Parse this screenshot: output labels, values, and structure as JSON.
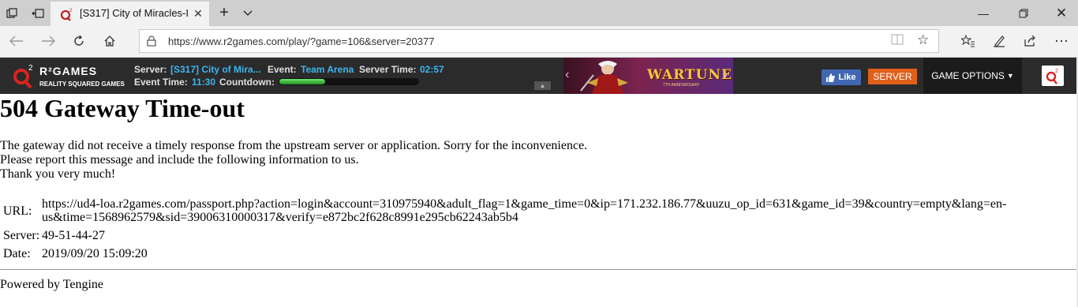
{
  "browser": {
    "tab_title": "[S317] City of Miracles-I",
    "url": "https://www.r2games.com/play/?game=106&server=20377"
  },
  "gamebar": {
    "logo_name": "R²GAMES",
    "logo_sub": "REALITY SQUARED GAMES",
    "server_label": "Server:",
    "server_value": "[S317] City of Mira...",
    "event_label": "Event:",
    "event_value": "Team Arena",
    "server_time_label": "Server Time:",
    "server_time_value": "02:57",
    "event_time_label": "Event Time:",
    "event_time_value": "11:30",
    "countdown_label": "Countdown:",
    "countdown_progress": 0.33,
    "banner_title": "WARTUNE",
    "banner_sub": "7TH ANNIVERSARY",
    "like_label": "Like",
    "server_button": "SERVER",
    "game_options": "GAME OPTIONS"
  },
  "page": {
    "title": "504 Gateway Time-out",
    "line1": "The gateway did not receive a timely response from the upstream server or application. Sorry for the inconvenience.",
    "line2": "Please report this message and include the following information to us.",
    "line3": "Thank you very much!",
    "url_label": "URL:",
    "url_value_1": "https://ud4-loa.r2games.com/passport.php?action=login&account=310975940&adult_flag=1&game_time=0&ip=171.232.186.77&uuzu_op_id=631&game_id=39&country=empty&lang=en-",
    "url_value_2": "us&time=1568962579&sid=39006310000317&verify=e872bc2f628c8991e295cb62243ab5b4",
    "server_label": "Server:",
    "server_value": "49-51-44-27",
    "date_label": "Date:",
    "date_value": "2019/09/20 15:09:20",
    "footer": "Powered by Tengine"
  },
  "colors": {
    "gamebar_bg": "#2b2b2b",
    "accent_blue": "#3db5f0",
    "server_orange": "#e0601a",
    "facebook_blue": "#4267b2"
  }
}
